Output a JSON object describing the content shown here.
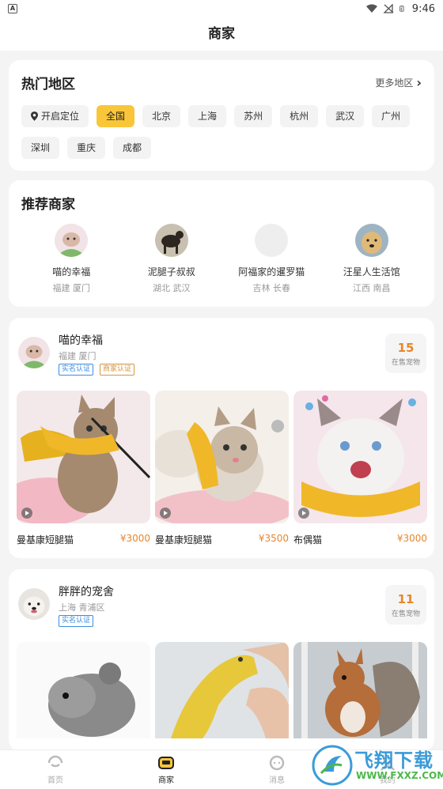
{
  "status": {
    "time": "9:46",
    "app_icon": "A"
  },
  "header": {
    "title": "商家"
  },
  "hot_regions": {
    "title": "热门地区",
    "more_label": "更多地区",
    "locate_label": "开启定位",
    "regions": [
      "全国",
      "北京",
      "上海",
      "苏州",
      "杭州",
      "武汉",
      "广州",
      "深圳",
      "重庆",
      "成都"
    ],
    "selected": "全国"
  },
  "recommended": {
    "title": "推荐商家",
    "items": [
      {
        "name": "喵的幸福",
        "location": "福建 厦门"
      },
      {
        "name": "泥腿子叔叔",
        "location": "湖北 武汉"
      },
      {
        "name": "阿福家的暹罗猫",
        "location": "吉林 长春"
      },
      {
        "name": "汪星人生活馆",
        "location": "江西 南昌"
      }
    ]
  },
  "shops": [
    {
      "name": "喵的幸福",
      "location": "福建 厦门",
      "badges": [
        "实名认证",
        "商家认证"
      ],
      "count": "15",
      "count_label": "在售宠物",
      "pets": [
        {
          "name": "曼基康短腿猫",
          "price": "¥3000"
        },
        {
          "name": "曼基康短腿猫",
          "price": "¥3500"
        },
        {
          "name": "布偶猫",
          "price": "¥3000"
        }
      ]
    },
    {
      "name": "胖胖的宠舍",
      "location": "上海 青浦区",
      "badges": [
        "实名认证"
      ],
      "count": "11",
      "count_label": "在售宠物"
    }
  ],
  "tabbar": {
    "items": [
      {
        "label": "首页",
        "icon": "home-icon"
      },
      {
        "label": "商家",
        "icon": "shop-icon"
      },
      {
        "label": "消息",
        "icon": "message-icon"
      },
      {
        "label": "我的",
        "icon": "profile-icon"
      }
    ],
    "active": "商家"
  },
  "watermark": {
    "title": "飞翔下载",
    "url": "WWW.FXXZ.COM"
  },
  "colors": {
    "accent": "#f9c63a",
    "price": "#e8862a",
    "badge_blue": "#3b8ee0",
    "badge_orange": "#d8943d"
  }
}
